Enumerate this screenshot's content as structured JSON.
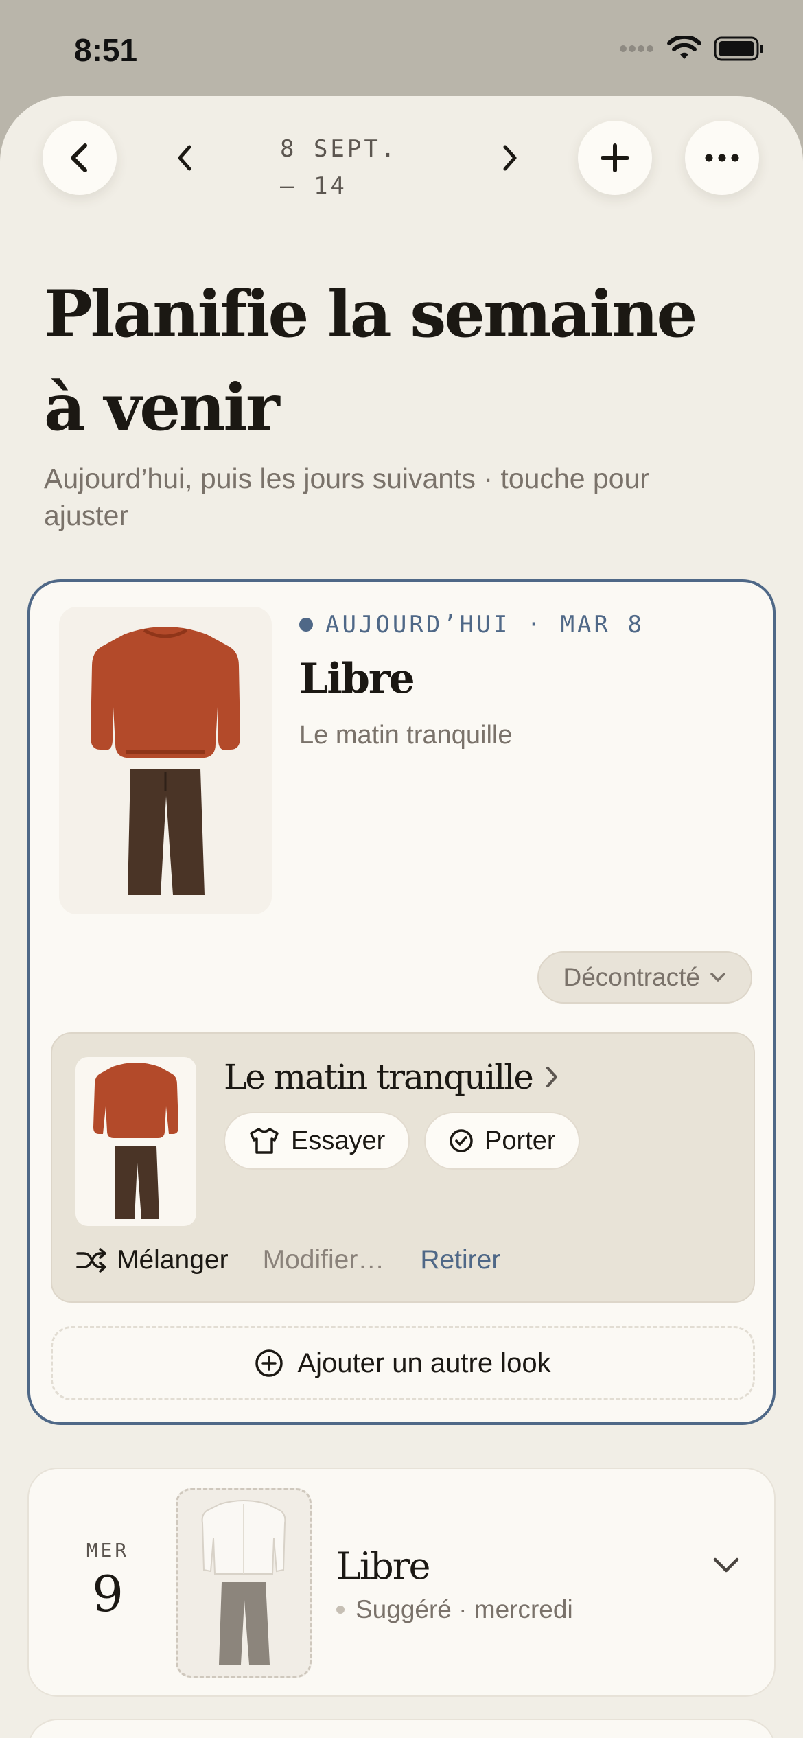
{
  "status_bar": {
    "time": "8:51"
  },
  "nav": {
    "week_range": "8 SEPT.\n— 14"
  },
  "header": {
    "title": "Planifie la semaine à venir",
    "subtitle": "Aujourd’hui, puis les jours suivants · touche pour ajuster"
  },
  "today": {
    "label": "AUJOURD’HUI · MAR 8",
    "name": "Libre",
    "subtitle": "Le matin tranquille",
    "style": "Décontracté",
    "look": {
      "title": "Le matin tranquille",
      "try_label": "Essayer",
      "wear_label": "Porter",
      "shuffle_label": "Mélanger",
      "modify_label": "Modifier…",
      "remove_label": "Retirer"
    },
    "add_look_label": "Ajouter un autre look"
  },
  "days": [
    {
      "dow": "MER",
      "day": "9",
      "name": "Libre",
      "subtitle": "Suggéré · mercredi"
    }
  ],
  "colors": {
    "accent": "#4f6887",
    "sheet_bg": "#f1eee6",
    "card_bg": "#fbf9f4",
    "sweater": "#b34a2a",
    "trousers": "#4a3426"
  }
}
